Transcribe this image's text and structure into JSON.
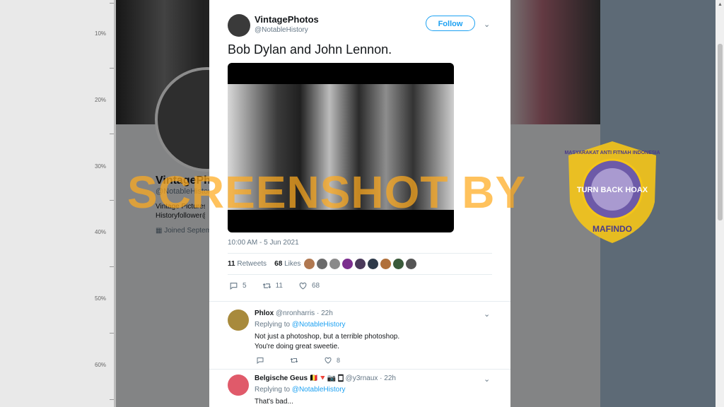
{
  "ruler": {
    "labels": [
      "10%",
      "20%",
      "30%",
      "40%",
      "50%",
      "60%"
    ]
  },
  "background_profile": {
    "name": "VintagePhotos",
    "handle": "@NotableHistory",
    "bio_lines": [
      "Vintage Pictures,",
      "Historyfollower@g"
    ],
    "joined": "Joined Septem"
  },
  "tweet": {
    "author_name": "VintagePhotos",
    "author_handle": "@NotableHistory",
    "follow_label": "Follow",
    "text": "Bob Dylan and John Lennon.",
    "timestamp": "10:00 AM - 5 Jun 2021",
    "retweets_count": "11",
    "retweets_label": "Retweets",
    "likes_count": "68",
    "likes_label": "Likes",
    "reply_count": "5",
    "retweet_count": "11",
    "like_count": "68",
    "liker_avatar_colors": [
      "#b07850",
      "#6a6a6a",
      "#8a8a8a",
      "#7b2e8e",
      "#4a3a5a",
      "#2e3a4a",
      "#b0703a",
      "#3a5a3a",
      "#555"
    ]
  },
  "replies": [
    {
      "name": "Phlox",
      "handle": "@nronharris",
      "time": "22h",
      "replying_label": "Replying to",
      "replying_to": "@NotableHistory",
      "lines": [
        "Not just a photoshop, but a terrible photoshop.",
        "You're doing great sweetie."
      ],
      "like_count": "8",
      "avatar_color": "#a88a3c"
    },
    {
      "name": "Belgische Geus 🇧🇪🔻📷 🀆",
      "handle": "@y3rnaux",
      "time": "22h",
      "replying_label": "Replying to",
      "replying_to": "@NotableHistory",
      "lines": [
        "That's bad..."
      ],
      "avatar_color": "#e05a6a"
    }
  ],
  "watermark": {
    "text": "SCREENSHOT BY"
  },
  "badge": {
    "top_text": "MASYARAKAT ANTI FITNAH INDONESIA",
    "center_text": "TURN BACK HOAX",
    "bottom_text": "MAFINDO"
  },
  "colors": {
    "accent": "#1da1f2",
    "watermark": "#ffaa1e",
    "badge": "#f5c518"
  }
}
